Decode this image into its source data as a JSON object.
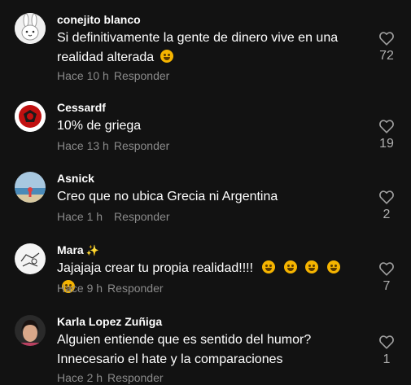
{
  "comments": [
    {
      "username": "conejito blanco",
      "text_lines": [
        "Si definitivamente la gente de dinero vive en una",
        "realidad alterada"
      ],
      "emojis": [
        "rolling-on-floor-laughing"
      ],
      "time": "Hace 10 h",
      "reply_label": "Responder",
      "likes": "72",
      "avatar": "white-rabbit"
    },
    {
      "username": "Cessardf",
      "text_lines": [
        "10% de griega"
      ],
      "time": "Hace 13 h",
      "reply_label": "Responder",
      "likes": "19",
      "avatar": "red-emblem"
    },
    {
      "username": "Asnick",
      "text_lines": [
        "Creo que no ubica Grecia ni Argentina"
      ],
      "time": "Hace 1 h",
      "reply_label": "Responder",
      "likes": "2",
      "avatar": "beach-photo"
    },
    {
      "username": "Mara",
      "username_badge": "✨",
      "text_lines": [
        "Jajajaja crear tu propia realidad!!!!"
      ],
      "emojis": [
        "grinning-sweat",
        "grinning-sweat",
        "grinning-sweat",
        "grinning-sweat",
        "grinning-sweat"
      ],
      "time": "Hace 9 h",
      "reply_label": "Responder",
      "likes": "7",
      "avatar": "sketch-drawing"
    },
    {
      "username": "Karla Lopez Zuñiga",
      "text_lines": [
        "Alguien entiende que es sentido del humor?",
        "Innecesario el hate y la comparaciones"
      ],
      "time": "Hace 2 h",
      "reply_label": "Responder",
      "likes": "1",
      "avatar": "portrait-photo"
    }
  ],
  "colors": {
    "background": "#121212",
    "text": "#ffffff",
    "meta": "#8a8a8a",
    "like_icon": "#a0a0a0",
    "emoji": "#f5b400"
  },
  "icons": {
    "like": "heart-outline-icon"
  }
}
